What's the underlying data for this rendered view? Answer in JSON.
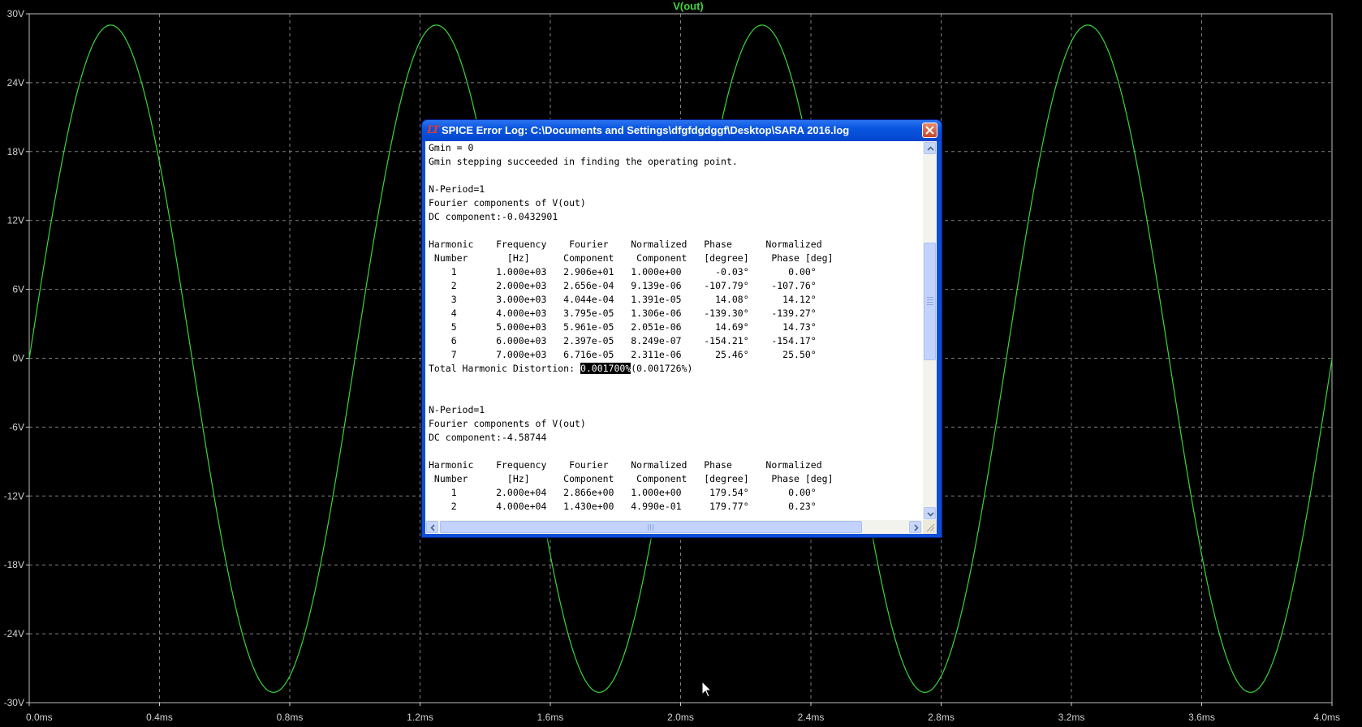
{
  "plot": {
    "trace_title": "V(out)",
    "trace_color": "#39d539",
    "grid_color": "#7f7f7f",
    "background": "#000000",
    "y_ticks": [
      "30V",
      "24V",
      "18V",
      "12V",
      "6V",
      "0V",
      "-6V",
      "-12V",
      "-18V",
      "-24V",
      "-30V"
    ],
    "x_ticks": [
      "0.0ms",
      "0.4ms",
      "0.8ms",
      "1.2ms",
      "1.6ms",
      "2.0ms",
      "2.4ms",
      "2.8ms",
      "3.2ms",
      "3.6ms",
      "4.0ms"
    ]
  },
  "chart_data": {
    "type": "line",
    "title": "V(out)",
    "xlabel": "",
    "ylabel": "",
    "xlim": [
      0,
      4.0
    ],
    "ylim": [
      -30,
      30
    ],
    "grid": true,
    "series": [
      {
        "name": "V(out)",
        "frequency_khz": 1.0,
        "amplitude_v": 29.06,
        "dc_offset_v": -0.0432901,
        "phase_deg": -0.03
      }
    ]
  },
  "error_log": {
    "title": "SPICE Error Log: C:\\Documents and Settings\\dfgfdgdggf\\Desktop\\SARA 2016.log",
    "app_icon": "LT",
    "lines": [
      {
        "text": "Gmin = 0"
      },
      {
        "text": "Gmin stepping succeeded in finding the operating point."
      },
      {
        "text": ""
      },
      {
        "text": "N-Period=1"
      },
      {
        "text": "Fourier components of V(out)"
      },
      {
        "text": "DC component:-0.0432901"
      },
      {
        "text": ""
      },
      {
        "text": "Harmonic    Frequency    Fourier    Normalized   Phase      Normalized"
      },
      {
        "text": " Number       [Hz]      Component    Component   [degree]    Phase [deg]"
      },
      {
        "text": "    1       1.000e+03   2.906e+01   1.000e+00      -0.03°       0.00°"
      },
      {
        "text": "    2       2.000e+03   2.656e-04   9.139e-06    -107.79°    -107.76°"
      },
      {
        "text": "    3       3.000e+03   4.044e-04   1.391e-05      14.08°      14.12°"
      },
      {
        "text": "    4       4.000e+03   3.795e-05   1.306e-06    -139.30°    -139.27°"
      },
      {
        "text": "    5       5.000e+03   5.961e-05   2.051e-06      14.69°      14.73°"
      },
      {
        "text": "    6       6.000e+03   2.397e-05   8.249e-07    -154.21°    -154.17°"
      },
      {
        "text": "    7       7.000e+03   6.716e-05   2.311e-06      25.46°      25.50°"
      },
      {
        "text": "Total Harmonic Distortion: ",
        "highlight": "0.001700%",
        "after": "(0.001726%)"
      },
      {
        "text": ""
      },
      {
        "text": ""
      },
      {
        "text": "N-Period=1"
      },
      {
        "text": "Fourier components of V(out)"
      },
      {
        "text": "DC component:-4.58744"
      },
      {
        "text": ""
      },
      {
        "text": "Harmonic    Frequency    Fourier    Normalized   Phase      Normalized"
      },
      {
        "text": " Number       [Hz]      Component    Component   [degree]    Phase [deg]"
      },
      {
        "text": "    1       2.000e+04   2.866e+00   1.000e+00     179.54°       0.00°"
      },
      {
        "text": "    2       4.000e+04   1.430e+00   4.990e-01     179.77°       0.23°"
      }
    ]
  }
}
